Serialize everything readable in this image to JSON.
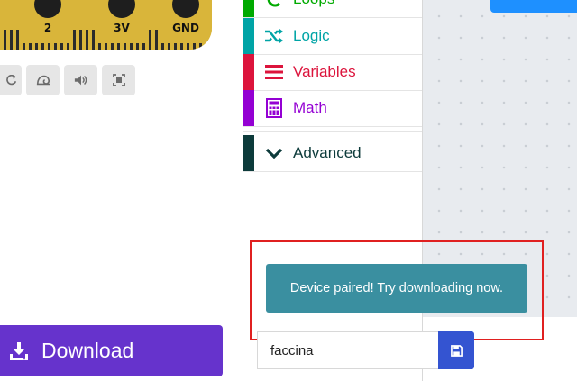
{
  "board": {
    "pins": [
      {
        "label": "2"
      },
      {
        "label": "3V"
      },
      {
        "label": "GND"
      }
    ]
  },
  "sim_toolbar": {
    "buttons": [
      {
        "icon": "restart-icon"
      },
      {
        "icon": "slow-motion-icon"
      },
      {
        "icon": "sound-icon"
      },
      {
        "icon": "fullscreen-icon"
      }
    ]
  },
  "download": {
    "label": "Download",
    "icon": "download-icon",
    "color": "#6633cc"
  },
  "toolbox": {
    "categories": [
      {
        "label": "Loops",
        "icon": "loop-icon",
        "color": "#00aa00"
      },
      {
        "label": "Logic",
        "icon": "shuffle-icon",
        "color": "#00a4a6"
      },
      {
        "label": "Variables",
        "icon": "variables-icon",
        "color": "#dc143c"
      },
      {
        "label": "Math",
        "icon": "calculator-icon",
        "color": "#9400d3"
      },
      {
        "label": "Advanced",
        "icon": "chevron-down-icon",
        "color": "#0d3b3b"
      }
    ]
  },
  "toast": {
    "message": "Device paired! Try downloading now.",
    "color": "#3a8fa0"
  },
  "project": {
    "name": "faccina",
    "save_icon": "save-icon",
    "save_color": "#3454d1"
  }
}
